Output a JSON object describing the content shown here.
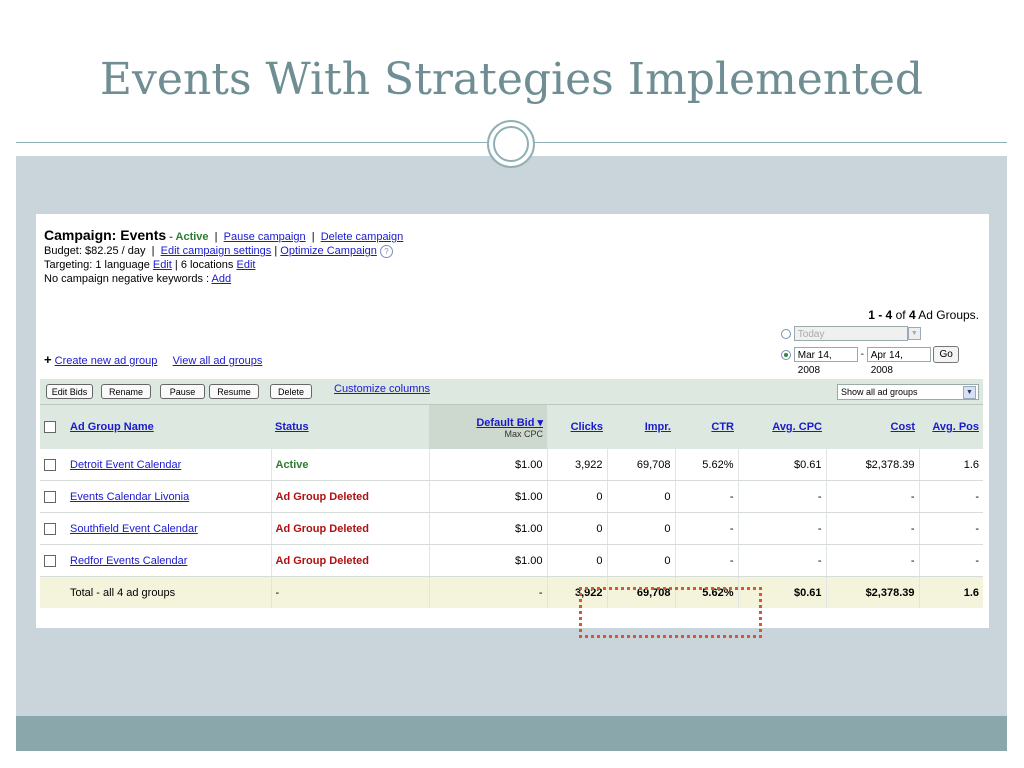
{
  "slide": {
    "title": "Events With Strategies Implemented"
  },
  "campaign": {
    "label": "Campaign: Events",
    "status_separator": " - ",
    "status": "Active",
    "pause_link": "Pause campaign",
    "delete_link": "Delete campaign",
    "budget_text": "Budget: $82.25 / day",
    "edit_settings_link": "Edit campaign settings",
    "optimize_link": "Optimize Campaign",
    "targeting_text": "Targeting: 1 language",
    "edit_link": "Edit",
    "locations_text": "6 locations",
    "negative_text": "No campaign negative keywords :",
    "add_link": "Add"
  },
  "pager": {
    "range": "1 - 4",
    "of": "of",
    "total": "4",
    "suffix": "Ad Groups."
  },
  "links": {
    "create_ad_group": "Create new ad group",
    "view_all": "View all ad groups"
  },
  "date_range": {
    "preset_value": "Today",
    "start_date": "Mar 14, 2008",
    "dash": "-",
    "end_date": "Apr 14, 2008",
    "go_label": "Go",
    "custom_selected": true
  },
  "toolbar": {
    "edit_bids": "Edit Bids",
    "rename": "Rename",
    "pause": "Pause",
    "resume": "Resume",
    "delete": "Delete",
    "customize": "Customize columns",
    "show_filter": "Show all ad groups"
  },
  "table": {
    "headers": {
      "name": "Ad Group Name",
      "status": "Status",
      "default_bid": "Default Bid ▾",
      "default_bid_sub": "Max CPC",
      "clicks": "Clicks",
      "impr": "Impr.",
      "ctr": "CTR",
      "avg_cpc": "Avg. CPC",
      "cost": "Cost",
      "avg_pos": "Avg. Pos"
    },
    "rows": [
      {
        "name": "Detroit Event Calendar",
        "status": "Active",
        "bid": "$1.00",
        "clicks": "3,922",
        "impr": "69,708",
        "ctr": "5.62%",
        "avg_cpc": "$0.61",
        "cost": "$2,378.39",
        "avg_pos": "1.6"
      },
      {
        "name": "Events Calendar Livonia",
        "status": "Ad Group Deleted",
        "bid": "$1.00",
        "clicks": "0",
        "impr": "0",
        "ctr": "-",
        "avg_cpc": "-",
        "cost": "-",
        "avg_pos": "-"
      },
      {
        "name": "Southfield Event Calendar",
        "status": "Ad Group Deleted",
        "bid": "$1.00",
        "clicks": "0",
        "impr": "0",
        "ctr": "-",
        "avg_cpc": "-",
        "cost": "-",
        "avg_pos": "-"
      },
      {
        "name": "Redfor Events Calendar",
        "status": "Ad Group Deleted",
        "bid": "$1.00",
        "clicks": "0",
        "impr": "0",
        "ctr": "-",
        "avg_cpc": "-",
        "cost": "-",
        "avg_pos": "-"
      }
    ],
    "total": {
      "name": "Total - all 4 ad groups",
      "status": "-",
      "bid": "-",
      "clicks": "3,922",
      "impr": "69,708",
      "ctr": "5.62%",
      "avg_cpc": "$0.61",
      "cost": "$2,378.39",
      "avg_pos": "1.6"
    }
  },
  "colors": {
    "status_active": "#2e7d32",
    "status_deleted": "#b01010",
    "highlight_box": "#d25a2c"
  }
}
